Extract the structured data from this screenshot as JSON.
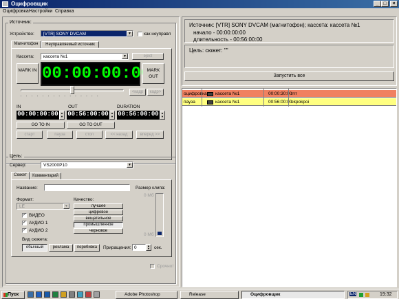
{
  "window": {
    "title": "Оцифровщик"
  },
  "menu": [
    "Оцифровка",
    "Настройки",
    "Справка"
  ],
  "source": {
    "group_label": "Источник:",
    "device_label": "Устройство:",
    "device_value": "[VTR]  SONY DVCAM",
    "as_unmanaged_label": "как неуправл",
    "tabs": [
      "Магнитофон",
      "Неуправляемый источник"
    ],
    "cassette_label": "Кассета:",
    "cassette_value": "кассета №1",
    "eject_label": "eject",
    "mark_in": "MARK IN",
    "mark_out": "MARK OUT",
    "timecode": "00:00:00:00",
    "frame_back": "<кадр",
    "frame_fwd": "кадр>",
    "in_label": "IN",
    "out_label": "OUT",
    "duration_label": "DURATION",
    "in_value": "00:00:00:00",
    "out_value": "00:56:00:00",
    "duration_value": "00:56:00:00",
    "goto_in": "GO TO  IN",
    "goto_out": "GO TO  OUT",
    "transport": [
      "старт",
      "пауза",
      "стоп",
      "<< назад",
      "вперед >>"
    ]
  },
  "target": {
    "group_label": "Цель:",
    "server_label": "Сервер:",
    "server_value": "VS2000P10",
    "tabs": [
      "Сюжет",
      "Комментарий"
    ],
    "name_label": "Название:",
    "name_value": "",
    "clip_size_label": "Размер клипа:",
    "clip_size_top": "0 Мб",
    "clip_size_bottom": "0 Мб",
    "format_label": "Формат:",
    "format_value": "LE",
    "quality_label": "Качество:",
    "quality_options": [
      "лучшее",
      "цифровое",
      "вещательное",
      "промышленное",
      "черновое"
    ],
    "quality_selected": "промышленное",
    "channels": [
      {
        "label": "ВИДЕО",
        "checked": true
      },
      {
        "label": "АУДИО 1",
        "checked": true
      },
      {
        "label": "АУДИО 2",
        "checked": true
      }
    ],
    "story_type_label": "Вид сюжета:",
    "story_types": [
      "обычный",
      "реклама",
      "перебивка"
    ],
    "increment_label": "Приращения:",
    "increment_value": "0",
    "increment_unit": "сек.",
    "urgent_label": "Срочно!"
  },
  "info": {
    "source_line": "Источник: [VTR]  SONY DVCAM (магнитофон); кассета: кассета №1",
    "start_line": "начало - 00:00:00:00",
    "duration_line": "длительность - 00:56:00:00",
    "target_line": "Цель:  сюжет: \"\"",
    "run_all": "Запустить все"
  },
  "queue": [
    {
      "status": "оцифровка",
      "cassette": "кассета №1",
      "time": "00:00:30:00",
      "name": "rrrr",
      "color": "#f08060"
    },
    {
      "status": "пауза",
      "cassette": "кассета №1",
      "time": "00:56:00:00",
      "name": "okpokpoi",
      "color": "#ffff80"
    }
  ],
  "taskbar": {
    "start": "Пуск",
    "items": [
      "Adobe Photoshop",
      "Release",
      "Оцифровщик"
    ],
    "lang": "EN",
    "clock": "19:32"
  }
}
